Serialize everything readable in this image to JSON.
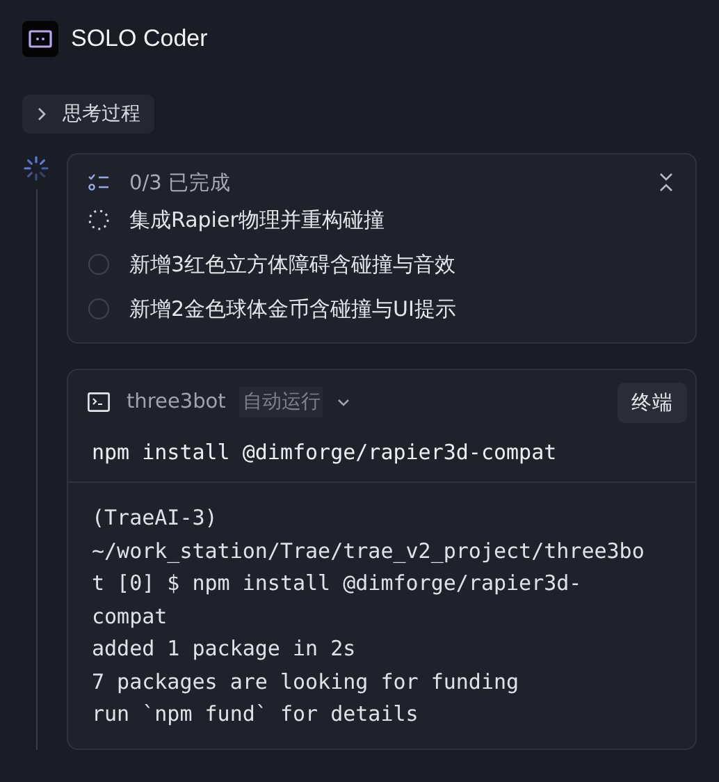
{
  "header": {
    "title": "SOLO Coder"
  },
  "thinking": {
    "label": "思考过程",
    "expanded": false
  },
  "todo": {
    "summary": "0/3 已完成",
    "items": [
      {
        "text": "集成Rapier物理并重构碰撞",
        "kind": "running"
      },
      {
        "text": "新增3红色立方体障碍含碰撞与音效",
        "kind": "pending"
      },
      {
        "text": "新增2金色球体金币含碰撞与UI提示",
        "kind": "pending"
      }
    ]
  },
  "terminal": {
    "name": "three3bot",
    "mode": "自动运行",
    "button": "终端",
    "command": "npm install @dimforge/rapier3d-compat",
    "output": [
      "(TraeAI-3)",
      "~/work_station/Trae/trae_v2_project/three3bo",
      "t [0] $ npm install @dimforge/rapier3d-",
      "compat",
      "added 1 package in 2s",
      "7 packages are looking for funding",
      "run `npm fund` for details"
    ]
  }
}
